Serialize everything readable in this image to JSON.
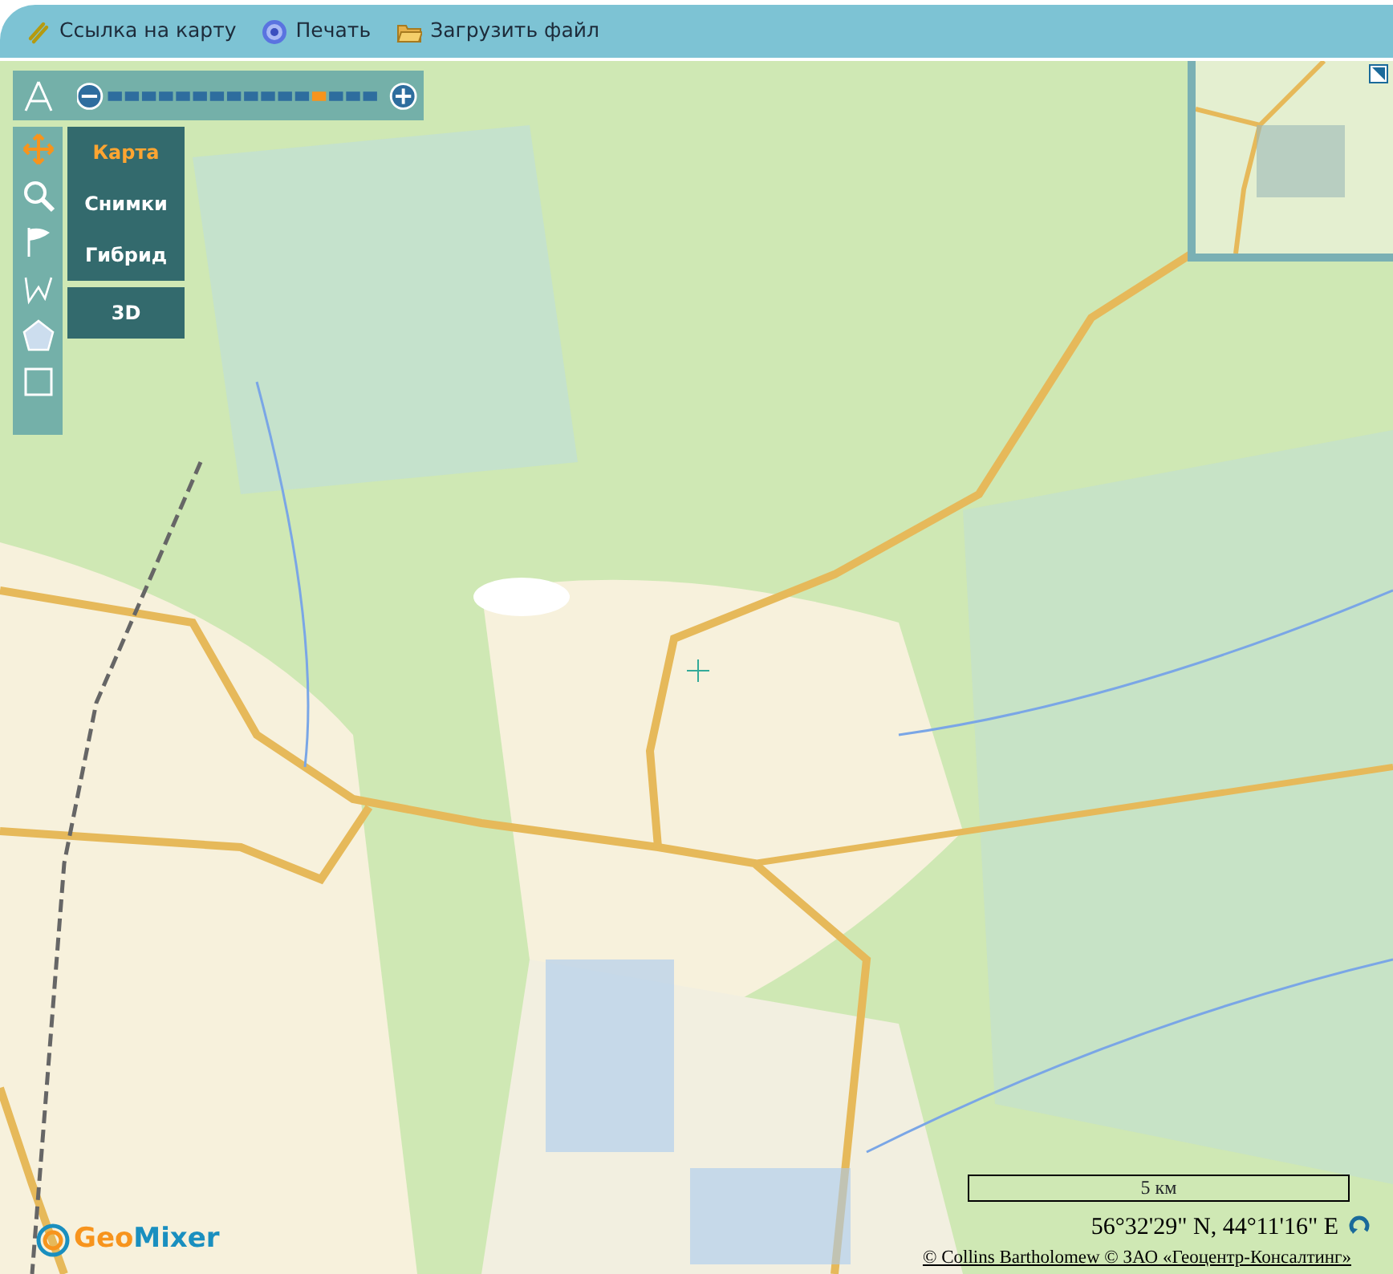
{
  "toolbar": {
    "items": [
      {
        "kind": "link",
        "label": "Ссылка на карту"
      },
      {
        "kind": "print",
        "label": "Печать"
      },
      {
        "kind": "folder",
        "label": "Загрузить файл"
      }
    ]
  },
  "zoom": {
    "level": 0.8
  },
  "tools": [
    {
      "kind": "ruler",
      "selected": false
    },
    {
      "kind": "move",
      "selected": true
    },
    {
      "kind": "zoom",
      "selected": false
    },
    {
      "kind": "flag",
      "selected": false
    },
    {
      "kind": "polyline",
      "selected": false
    },
    {
      "kind": "polygon",
      "selected": false
    },
    {
      "kind": "rectangle",
      "selected": false
    }
  ],
  "map_types": [
    {
      "label": "Карта",
      "selected": true
    },
    {
      "label": "Снимки",
      "selected": false
    },
    {
      "label": "Гибрид",
      "selected": false
    },
    {
      "label": "3D",
      "selected": false
    }
  ],
  "scale": "5 км",
  "coordinates": "56°32'29\" N, 44°11'16\" E",
  "copyright": "© Collins Bartholomew © ЗАО «Геоцентр-Консалтинг»",
  "logo": {
    "part_1": "Geo",
    "part_2": "Mixer"
  }
}
